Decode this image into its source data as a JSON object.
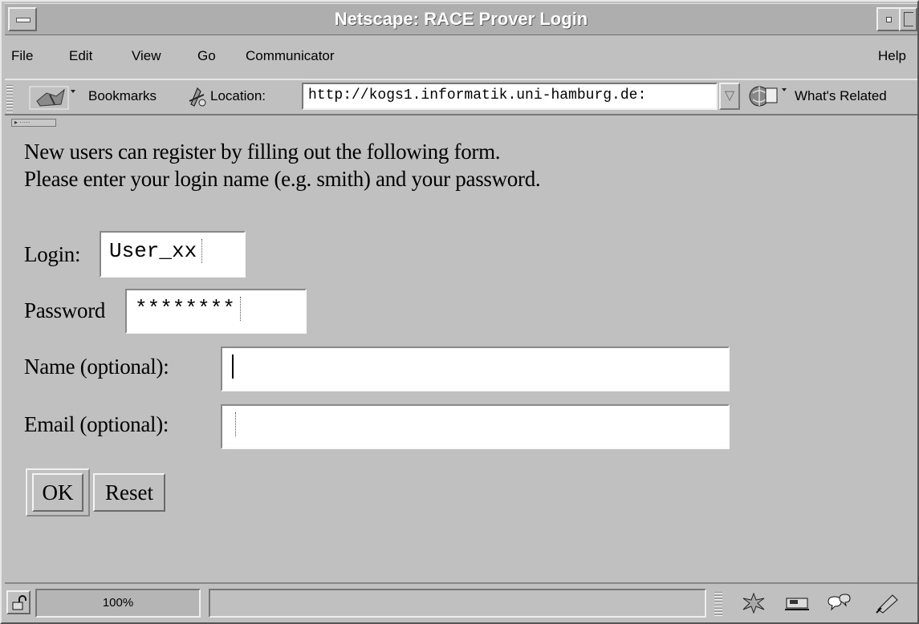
{
  "window": {
    "title": "Netscape: RACE Prover Login"
  },
  "menubar": {
    "items": [
      "File",
      "Edit",
      "View",
      "Go",
      "Communicator"
    ],
    "help": "Help"
  },
  "toolbar": {
    "bookmarks_label": "Bookmarks",
    "location_label": "Location:",
    "location_url": "http://kogs1.informatik.uni-hamburg.de:",
    "whats_related_label": "What's Related"
  },
  "page": {
    "intro_line1": "New users can register by filling out the following form.",
    "intro_line2": "Please enter your login name (e.g. smith) and your password.",
    "form": {
      "login_label": "Login:",
      "login_value": "User_xx",
      "password_label": "Password",
      "password_value": "********",
      "name_label": "Name (optional):",
      "name_value": "",
      "email_label": "Email (optional):",
      "email_value": "",
      "ok_label": "OK",
      "reset_label": "Reset"
    }
  },
  "statusbar": {
    "progress": "100%",
    "status_text": ""
  },
  "icons": {
    "bookmarks": "bookmarks-icon",
    "location": "location-icon",
    "whats_related": "whats-related-icon",
    "security": "padlock-icon",
    "navigator": "navigator-icon",
    "mail": "mail-icon",
    "discussion": "discussion-icon",
    "composer": "composer-icon"
  }
}
